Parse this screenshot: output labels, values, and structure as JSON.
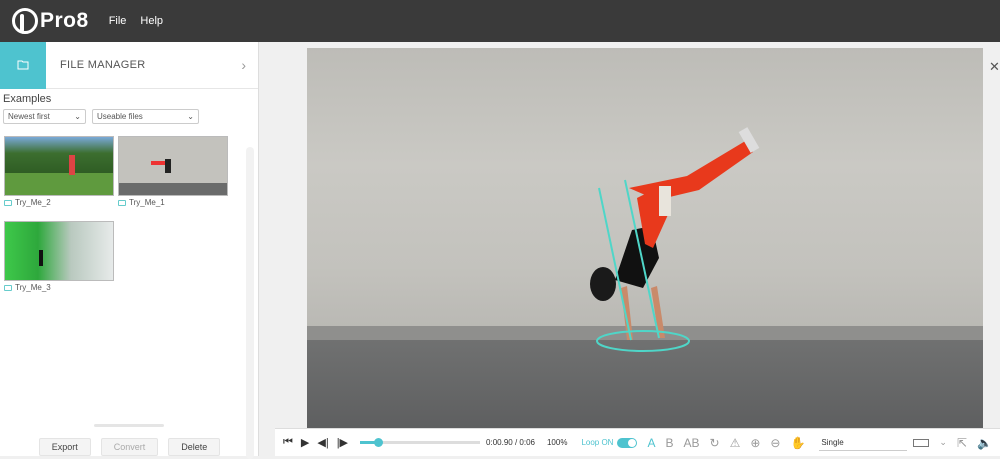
{
  "app": {
    "logo_text": "Pro8"
  },
  "menu": [
    {
      "label": "File"
    },
    {
      "label": "Help"
    }
  ],
  "file_manager": {
    "title": "FILE MANAGER",
    "section": "Examples",
    "sort_select": "Newest first",
    "filter_select": "Useable files",
    "items": [
      {
        "name": "Try_Me_2"
      },
      {
        "name": "Try_Me_1"
      },
      {
        "name": "Try_Me_3"
      }
    ],
    "actions": {
      "export": "Export",
      "convert": "Convert",
      "delete": "Delete"
    }
  },
  "player": {
    "time": "0:00.90 / 0:06",
    "zoom": "100%",
    "loop_label": "Loop ON",
    "loop_on": true,
    "progress": 0.15,
    "mode_select": "Single",
    "tools": {
      "text_a": "A",
      "bold_b": "B",
      "ab": "AB"
    }
  },
  "colors": {
    "accent": "#4ec3cf",
    "topbar": "#3a3a3a"
  },
  "icons": [
    "folder-icon",
    "chevron-right-icon",
    "close-icon",
    "skip-start-icon",
    "play-icon",
    "step-back-icon",
    "step-forward-icon",
    "rotate-icon",
    "warning-icon",
    "zoom-in-icon",
    "zoom-out-icon",
    "hand-icon",
    "export-icon",
    "volume-icon"
  ]
}
